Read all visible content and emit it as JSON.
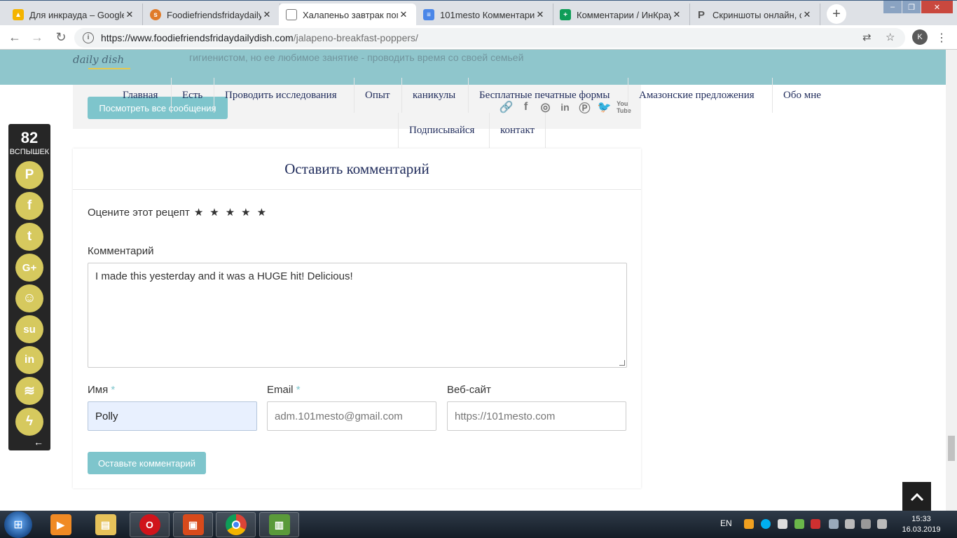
{
  "browser": {
    "tabs": [
      {
        "title": "Для инкрауда – Google",
        "icon": "google-drive-icon",
        "color": "#f4b400",
        "active": false
      },
      {
        "title": "Foodiefriendsfridaydaily",
        "icon": "site-favicon-icon",
        "color": "#e07b2a",
        "active": false
      },
      {
        "title": "Халапеньо завтрак поп",
        "icon": "page-icon",
        "color": "#ffffff",
        "active": true
      },
      {
        "title": "101mesto Комментари",
        "icon": "google-docs-icon",
        "color": "#4a86e8",
        "active": false
      },
      {
        "title": "Комментарии / ИнКрау",
        "icon": "google-sheets-icon",
        "color": "#0f9d58",
        "active": false
      },
      {
        "title": "Скриншоты онлайн, сер",
        "icon": "p-letter-icon",
        "color": "#555555",
        "active": false
      }
    ],
    "url_host": "https://www.foodiefriendsfridaydailydish.com",
    "url_path": "/jalapeno-breakfast-poppers/",
    "profile_initial": "K"
  },
  "site": {
    "logo": "daily dish",
    "ghost_bio": "гигиенистом, но ее любимое занятие - проводить время со своей семьей",
    "view_all_posts": "Посмотреть все сообщения",
    "social_icons": [
      "link-icon",
      "facebook-icon",
      "instagram-icon",
      "linkedin-icon",
      "pinterest-icon",
      "twitter-icon",
      "youtube-icon"
    ],
    "menu": [
      "Главная",
      "Есть",
      "Проводить исследования",
      "Опыт",
      "каникулы",
      "Бесплатные печатные формы",
      "Амазонские предложения",
      "Обо мне",
      "Подписывайся",
      "контакт"
    ]
  },
  "comment_form": {
    "title": "Оставить комментарий",
    "rate_label": "Оцените этот рецепт",
    "stars": "★★★★★",
    "comment_label": "Комментарий",
    "comment_value": "I made this yesterday and it was a HUGE hit! Delicious!",
    "name_label": "Имя",
    "email_label": "Email",
    "website_label": "Веб-сайт",
    "required_mark": "*",
    "name_value": "Polly",
    "email_value": "adm.101mesto@gmail.com",
    "website_value": "https://101mesto.com",
    "submit": "Оставьте комментарий"
  },
  "share": {
    "count": "82",
    "count_label": "ВСПЫШЕК",
    "buttons": [
      "pinterest-icon",
      "facebook-icon",
      "twitter-icon",
      "google-plus-icon",
      "reddit-icon",
      "stumbleupon-icon",
      "linkedin-icon",
      "buffer-icon",
      "flash-icon"
    ]
  },
  "taskbar": {
    "lang": "EN",
    "time": "15:33",
    "date": "16.03.2019"
  },
  "colors": {
    "accent": "#7ec5cc",
    "header_teal": "#8fc6cc",
    "heading_navy": "#1e2a5a",
    "share_gold": "#d6c95e"
  }
}
